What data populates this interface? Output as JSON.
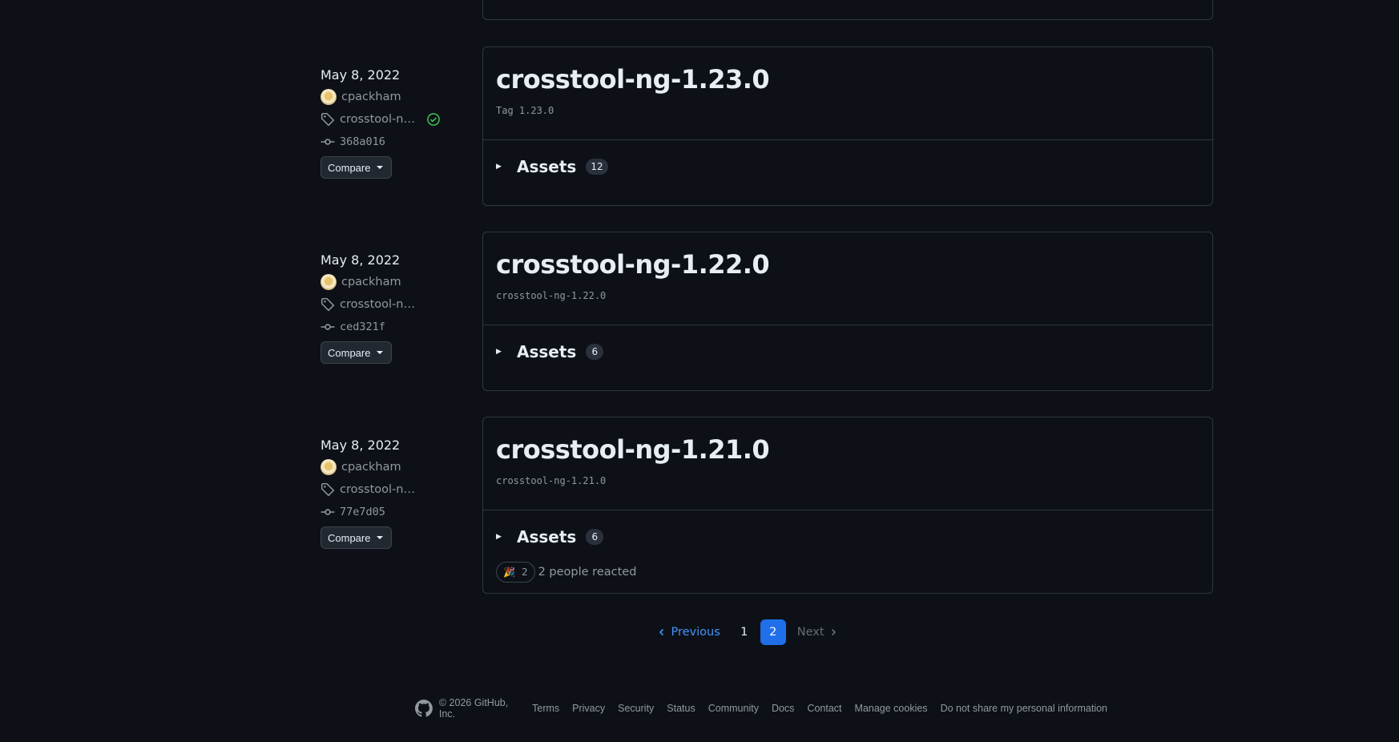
{
  "releases": [
    {
      "date": "May 8, 2022",
      "author": "cpackham",
      "tag": "crosstool-ng-...",
      "verified": true,
      "commit": "368a016",
      "compare_label": "Compare",
      "title": "crosstool-ng-1.23.0",
      "subtitle": "Tag 1.23.0",
      "assets_label": "Assets",
      "assets_count": "12"
    },
    {
      "date": "May 8, 2022",
      "author": "cpackham",
      "tag": "crosstool-ng-...",
      "verified": false,
      "commit": "ced321f",
      "compare_label": "Compare",
      "title": "crosstool-ng-1.22.0",
      "subtitle": "crosstool-ng-1.22.0",
      "assets_label": "Assets",
      "assets_count": "6"
    },
    {
      "date": "May 8, 2022",
      "author": "cpackham",
      "tag": "crosstool-ng-...",
      "verified": false,
      "commit": "77e7d05",
      "compare_label": "Compare",
      "title": "crosstool-ng-1.21.0",
      "subtitle": "crosstool-ng-1.21.0",
      "assets_label": "Assets",
      "assets_count": "6",
      "reaction_emoji": "🎉",
      "reaction_count": "2",
      "reaction_text": "2 people reacted"
    }
  ],
  "pagination": {
    "previous": "Previous",
    "pages": [
      "1",
      "2"
    ],
    "current": "2",
    "next": "Next"
  },
  "footer": {
    "copyright": "© 2026 GitHub, Inc.",
    "links": [
      "Terms",
      "Privacy",
      "Security",
      "Status",
      "Community",
      "Docs",
      "Contact",
      "Manage cookies",
      "Do not share my personal information"
    ]
  },
  "colors": {
    "background": "#0d1117",
    "border": "#30363d",
    "accent": "#4493f8",
    "current_page": "#1f6feb",
    "verified": "#3fb950"
  }
}
